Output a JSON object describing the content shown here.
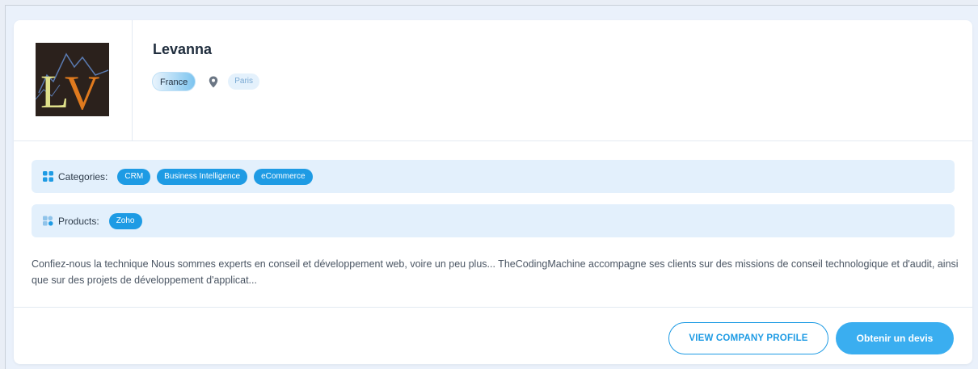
{
  "company": {
    "name": "Levanna",
    "logo_text": "LV",
    "country": "France",
    "city": "Paris"
  },
  "categories": {
    "label": "Categories:",
    "tags": [
      "CRM",
      "Business Intelligence",
      "eCommerce"
    ]
  },
  "products": {
    "label": "Products:",
    "tags": [
      "Zoho"
    ]
  },
  "description": "Confiez-nous la technique Nous sommes experts en conseil et développement web, voire un peu plus... TheCodingMachine accompagne ses clients sur des missions de conseil technologique et d'audit, ainsi que sur des projets de développement d'applicat...",
  "actions": {
    "view_profile": "VIEW COMPANY PROFILE",
    "get_quote": "Obtenir un devis"
  },
  "colors": {
    "accent": "#1e9be4",
    "bar_background": "#e3f0fc",
    "page_background": "#eaf1fb"
  }
}
